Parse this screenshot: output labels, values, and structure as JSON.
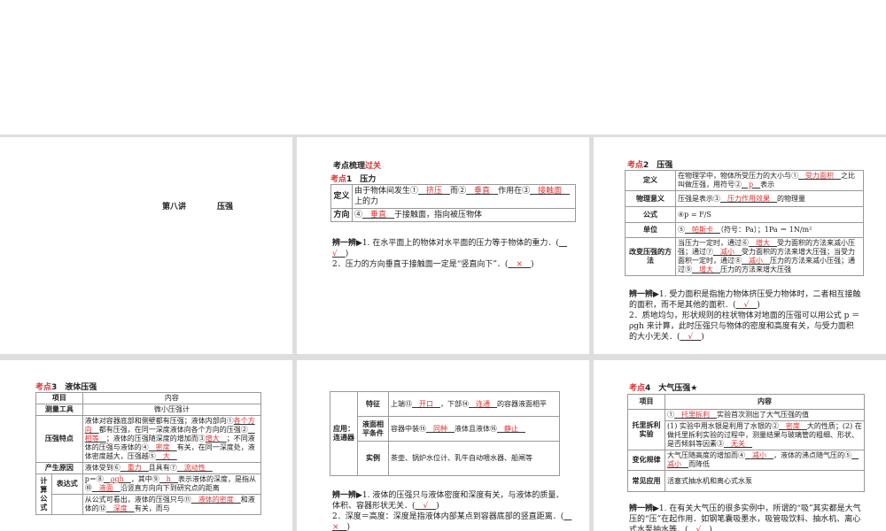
{
  "p1": {
    "lecture": "第八讲",
    "title": "压强"
  },
  "p2": {
    "heading": "考点梳理",
    "heading_red": "过关",
    "kd": "考点",
    "sub": "1　压力",
    "rows": [
      {
        "label": "定义",
        "content": [
          "由于物体间发生①",
          {
            "b": "　挤压　"
          },
          "而②",
          {
            "b": "　垂直　"
          },
          "作用在③",
          {
            "b": "　接触面　"
          },
          "上的力"
        ]
      },
      {
        "label": "方向",
        "content": [
          "④",
          {
            "b": "　垂直　"
          },
          "于接触面，指向被压物体"
        ]
      }
    ],
    "judge_label": "辨一辨▶",
    "judge": [
      [
        "1. 在水平面上的物体对水平面的压力等于物体的重力．(",
        {
          "b": "　√　"
        },
        ")"
      ],
      [
        "2．压力的方向垂直于接触面一定是“竖直向下”．(",
        {
          "b": "　×　"
        },
        ")"
      ]
    ]
  },
  "p3": {
    "kd": "考点",
    "sub": "2　压强",
    "rows": [
      {
        "label": "定义",
        "content": [
          "在物理学中，物体所受压力的大小与①",
          {
            "b": "　受力面积　"
          },
          "之比叫做压强，用符号②",
          {
            "b": "　p　"
          },
          "表示"
        ]
      },
      {
        "label": "物理意义",
        "content": [
          "压强是表示③",
          {
            "b": "　压力作用效果　"
          },
          "的物理量"
        ]
      },
      {
        "label": "公式",
        "content": [
          "④p = F/S"
        ]
      },
      {
        "label": "单位",
        "content": [
          "⑤",
          {
            "b": "　帕斯卡　"
          },
          "（符号：Pa）；1Pa ＝ 1N/m²"
        ]
      },
      {
        "label": "改变压强的方法",
        "content": [
          "当压力一定时，通过⑥",
          {
            "b": "　增大　"
          },
          "受力面积的方法来减小压强；通过⑦",
          {
            "b": "　减小　"
          },
          "受力面积的方法来增大压强；当受力面积一定时，通过⑧",
          {
            "b": "　减小　"
          },
          "压力的方法来减小压强；通过⑨",
          {
            "b": "　增大　"
          },
          "压力的方法来增大压强"
        ]
      }
    ],
    "judge_label": "辨一辨▶",
    "judge": [
      [
        "1. 受力面积是指施力物体挤压受力物体时，二者相互接触的面积，而不是其他的面积．(",
        {
          "b": "　√　"
        },
        ")"
      ],
      [
        "2．质地均匀，形状规则的柱状物体对地面的压强可以用公式 p ＝ ρgh 来计算，此时压强只与物体的密度和高度有关，与受力面积的大小无关．(",
        {
          "b": "　√　"
        },
        ")"
      ]
    ]
  },
  "p4": {
    "kd": "考点",
    "sub": "3　液体压强",
    "head": [
      "项目",
      "内容"
    ],
    "tool": {
      "label": "测量工具",
      "content": [
        "微小压强计"
      ]
    },
    "feature": {
      "label": "压强特点",
      "content": [
        "液体对容器底部和侧壁都有压强；液体内部向①",
        {
          "b": "各个方向　"
        },
        "都有压强，在同一深度液体向各个方向的压强②",
        {
          "b": "　相等　"
        },
        "；液体的压强随深度的增加而③",
        {
          "b": "增大　"
        },
        "；不同液体的压强与液体的④",
        {
          "b": "　密度　"
        },
        "有关，在同一深度处，液体密度越大，压强越⑤",
        {
          "b": "　大　"
        }
      ]
    },
    "cause": {
      "label": "产生原因",
      "content": [
        "液体受到⑥",
        {
          "b": "　重力　"
        },
        "且具有⑦",
        {
          "b": "　流动性　"
        }
      ]
    },
    "calc": {
      "label": "计算公式",
      "sub1": "表达式",
      "c1": [
        "p＝⑧",
        {
          "b": "　ρgh　"
        },
        "，其中⑨",
        {
          "b": "　h　"
        },
        "表示液体的深度，是指从⑩",
        {
          "b": "　液面　"
        },
        "沿竖直方向向下到研究点的距离"
      ],
      "c2": [
        "从公式可看出，液体的压强只与⑪",
        {
          "b": "　液体的密度　"
        },
        "和液体的⑫",
        {
          "b": "　深度　"
        },
        "有关，而与"
      ]
    }
  },
  "p5": {
    "group": "应用：连通器",
    "rows": [
      {
        "label": "特征",
        "content": [
          "上端⑬",
          {
            "b": "　开口　"
          },
          "，下部⑭",
          {
            "b": "　连通　"
          },
          "的容器液面相平"
        ]
      },
      {
        "label": "液面相平条件",
        "content": [
          "容器中装⑮",
          {
            "b": "　同种　"
          },
          "液体且液体⑯",
          {
            "b": "　静止　"
          }
        ]
      },
      {
        "label": "实例",
        "content": [
          "茶壶、锅炉水位计、乳牛自动喂水器、船闸等"
        ]
      }
    ],
    "judge_label": "辨一辨▶",
    "judge": [
      [
        "1. 液体的压强只与液体密度和深度有关，与液体的质量、体积、容器形状无关．(",
        {
          "b": "　√　"
        },
        ")"
      ],
      [
        "2．深度＝高度：深度是指液体内部某点到容器底部的竖直距离．(",
        {
          "b": "　×　"
        },
        ")"
      ]
    ]
  },
  "p6": {
    "kd": "考点",
    "sub": "4　大气压强★",
    "head": [
      "项目",
      "内容"
    ],
    "torr": {
      "label": "托里拆利实验",
      "c1": [
        "①",
        {
          "b": "　托里拆利　"
        },
        "实验首次测出了大气压强的值"
      ],
      "c2": [
        "(1) 实验中用水银是利用了水银的②",
        {
          "b": "　密度　"
        },
        "大的性质；(2) 在做托里拆利实验的过程中，测量结果与玻璃管的粗细、形状、是否倾斜等因素③",
        {
          "b": "　无关　"
        }
      ]
    },
    "rule": {
      "label": "变化规律",
      "content": [
        "大气压随高度的增加而④",
        {
          "b": "　减小　"
        },
        "，液体的沸点随气压的⑤",
        {
          "b": "　减小　"
        },
        "而降低"
      ]
    },
    "app": {
      "label": "常见应用",
      "content": [
        "活塞式抽水机和离心式水泵"
      ]
    },
    "judge_label": "辨一辨▶",
    "judge": [
      [
        "1. 在有关大气压的很多实例中，所谓的“吸”其实都是大气压的“压”在起作用．如钢笔囊吸墨水，吸管吸饮料、抽水机、离心式水泵抽水等．(",
        {
          "b": "　√　"
        },
        ")"
      ]
    ]
  }
}
